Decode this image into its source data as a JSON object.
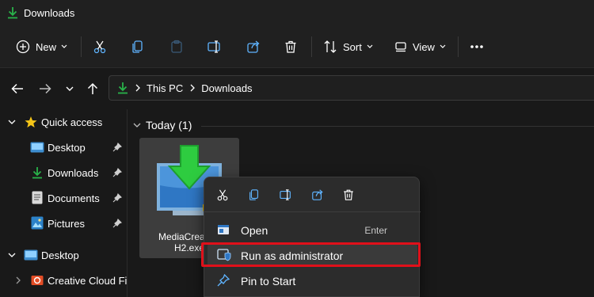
{
  "window": {
    "title": "Downloads"
  },
  "toolbar": {
    "new_label": "New",
    "sort_label": "Sort",
    "view_label": "View"
  },
  "address": {
    "crumbs": [
      "This PC",
      "Downloads"
    ]
  },
  "sidebar": {
    "items": [
      {
        "label": "Quick access"
      },
      {
        "label": "Desktop"
      },
      {
        "label": "Downloads"
      },
      {
        "label": "Documents"
      },
      {
        "label": "Pictures"
      },
      {
        "label": "Desktop"
      },
      {
        "label": "Creative Cloud File"
      }
    ]
  },
  "content": {
    "group_header": "Today (1)",
    "file": {
      "name_line1": "MediaCreation",
      "name_line2": "H2.exe"
    }
  },
  "context_menu": {
    "items": [
      {
        "label": "Open",
        "shortcut": "Enter"
      },
      {
        "label": "Run as administrator",
        "shortcut": ""
      },
      {
        "label": "Pin to Start",
        "shortcut": ""
      }
    ],
    "highlight_color": "#e0101a"
  },
  "colors": {
    "accent_green": "#29b34a",
    "background": "#191919",
    "toolbar": "#202020"
  }
}
